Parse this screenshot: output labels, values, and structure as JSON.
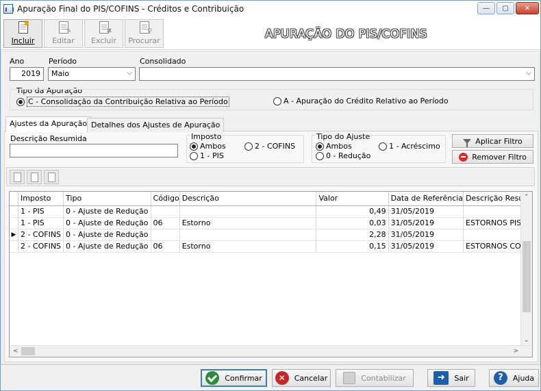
{
  "window": {
    "title": "Apuração Final do PIS/COFINS - Créditos e Contribuição",
    "minimize": "—",
    "maximize": "▢",
    "close": "✕"
  },
  "toolbar": {
    "incluir": "Incluir",
    "editar": "Editar",
    "excluir": "Excluir",
    "procurar": "Procurar",
    "header_title": "APURAÇÃO DO PIS/COFINS"
  },
  "form": {
    "ano_label": "Ano",
    "ano_value": "2019",
    "periodo_label": "Período",
    "periodo_value": "Maio",
    "consolidado_label": "Consolidado",
    "consolidado_value": "",
    "tipo_apuracao_label": "Tipo da Apuração",
    "tipo_c": "C - Consolidação da Contribuição Relativa ao Período",
    "tipo_a": "A - Apuração do Crédito Relativo ao Período"
  },
  "tabs": {
    "ajustes": "Ajustes da Apuração",
    "detalhes": "Detalhes dos Ajustes de Apuração"
  },
  "filter": {
    "descricao_label": "Descrição Resumida",
    "descricao_value": "",
    "imposto_label": "Imposto",
    "imposto_ambos": "Ambos",
    "imposto_cofins": "2 - COFINS",
    "imposto_pis": "1 - PIS",
    "tipo_ajuste_label": "Tipo do Ajuste",
    "tipo_ambos": "Ambos",
    "tipo_acrescimo": "1 - Acréscimo",
    "tipo_reducao": "0 - Redução",
    "aplicar": "Aplicar Filtro",
    "remover": "Remover Filtro"
  },
  "grid": {
    "columns": [
      "Imposto",
      "Tipo",
      "Código",
      "Descrição",
      "Valor",
      "Data de Referência",
      "Descrição Resu"
    ],
    "current_row_marker": "▶",
    "rows": [
      [
        "1 - PIS",
        "0 - Ajuste de Redução",
        "",
        "",
        "0,49",
        "31/05/2019",
        ""
      ],
      [
        "1 - PIS",
        "0 - Ajuste de Redução",
        "06",
        "Estorno",
        "0,03",
        "31/05/2019",
        "ESTORNOS PIS C"
      ],
      [
        "2 - COFINS",
        "0 - Ajuste de Redução",
        "",
        "",
        "2,28",
        "31/05/2019",
        ""
      ],
      [
        "2 - COFINS",
        "0 - Ajuste de Redução",
        "06",
        "Estorno",
        "0,15",
        "31/05/2019",
        "ESTORNOS COFI"
      ]
    ]
  },
  "footer": {
    "confirmar": "Confirmar",
    "cancelar": "Cancelar",
    "contabilizar": "Contabilizar",
    "sair": "Sair",
    "ajuda": "Ajuda"
  }
}
